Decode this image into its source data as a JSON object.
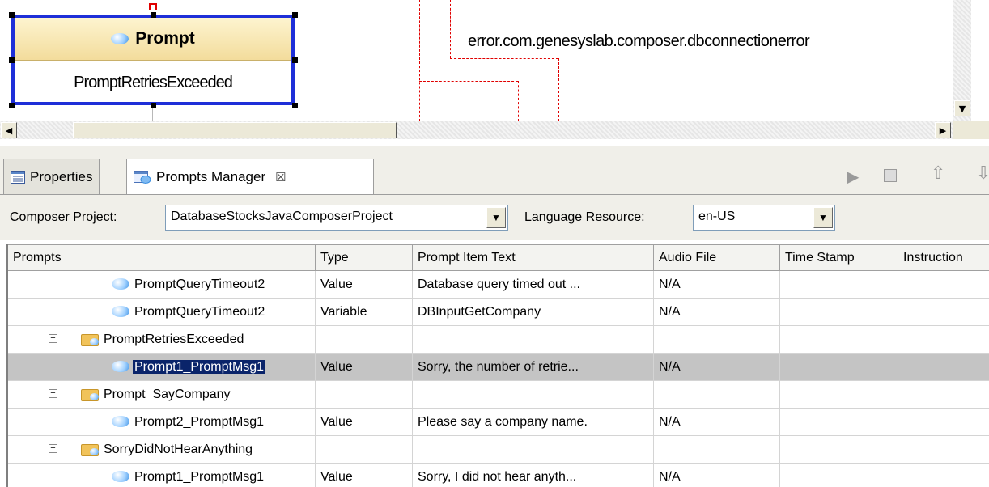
{
  "diagram": {
    "node_title": "Prompt",
    "node_name": "PromptRetriesExceeded",
    "edge_label": "error.com.genesyslab.composer.dbconnectionerror"
  },
  "tabs": {
    "properties": "Properties",
    "prompts_manager": "Prompts Manager",
    "close_glyph": "☒"
  },
  "selectors": {
    "project_label": "Composer Project:",
    "project_value": "DatabaseStocksJavaComposerProject",
    "language_label": "Language Resource:",
    "language_value": "en-US"
  },
  "table": {
    "columns": [
      "Prompts",
      "Type",
      "Prompt Item Text",
      "Audio File",
      "Time Stamp",
      "Instruction"
    ],
    "rows": [
      {
        "kind": "item",
        "name": "PromptQueryTimeout2",
        "type": "Value",
        "text": "Database query timed out ...",
        "audio": "N/A",
        "selected": false
      },
      {
        "kind": "item",
        "name": "PromptQueryTimeout2",
        "type": "Variable",
        "text": "DBInputGetCompany",
        "audio": "N/A",
        "selected": false
      },
      {
        "kind": "group",
        "name": "PromptRetriesExceeded",
        "type": "",
        "text": "",
        "audio": "",
        "selected": false
      },
      {
        "kind": "item",
        "name": "Prompt1_PromptMsg1",
        "type": "Value",
        "text": "Sorry, the number of retrie...",
        "audio": "N/A",
        "selected": true
      },
      {
        "kind": "group",
        "name": "Prompt_SayCompany",
        "type": "",
        "text": "",
        "audio": "",
        "selected": false
      },
      {
        "kind": "item",
        "name": "Prompt2_PromptMsg1",
        "type": "Value",
        "text": "Please say a company name.",
        "audio": "N/A",
        "selected": false
      },
      {
        "kind": "group",
        "name": "SorryDidNotHearAnything",
        "type": "",
        "text": "",
        "audio": "",
        "selected": false
      },
      {
        "kind": "item",
        "name": "Prompt1_PromptMsg1",
        "type": "Value",
        "text": "Sorry, I did not hear anyth...",
        "audio": "N/A",
        "selected": false
      }
    ]
  },
  "colors": {
    "selection": "#0a246a",
    "node_border": "#1e2fd8",
    "connector": "#e00000"
  }
}
